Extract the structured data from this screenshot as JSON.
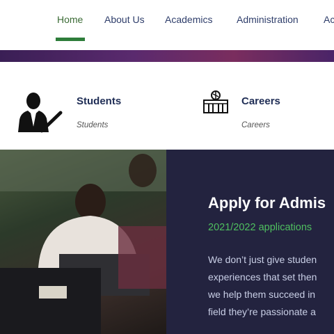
{
  "nav": {
    "items": [
      {
        "label": "Home",
        "active": true
      },
      {
        "label": "About Us"
      },
      {
        "label": "Academics"
      },
      {
        "label": "Administration"
      },
      {
        "label": "Ac"
      }
    ]
  },
  "quick_links": [
    {
      "title": "Students",
      "subtitle": "Students",
      "icon": "student-icon"
    },
    {
      "title": "Careers",
      "subtitle": "Careers",
      "icon": "building-icon"
    }
  ],
  "hero": {
    "title": "Apply for Admis",
    "subtitle": "2021/2022 applications",
    "lines": [
      "We don’t just give studen",
      "experiences that set then",
      "we help them succeed in",
      "field they’re passionate a"
    ]
  },
  "colors": {
    "nav_text": "#2f3e6b",
    "active": "#2e7d3a",
    "hero_bg": "#23233f",
    "hero_sub": "#4fbf5f"
  }
}
